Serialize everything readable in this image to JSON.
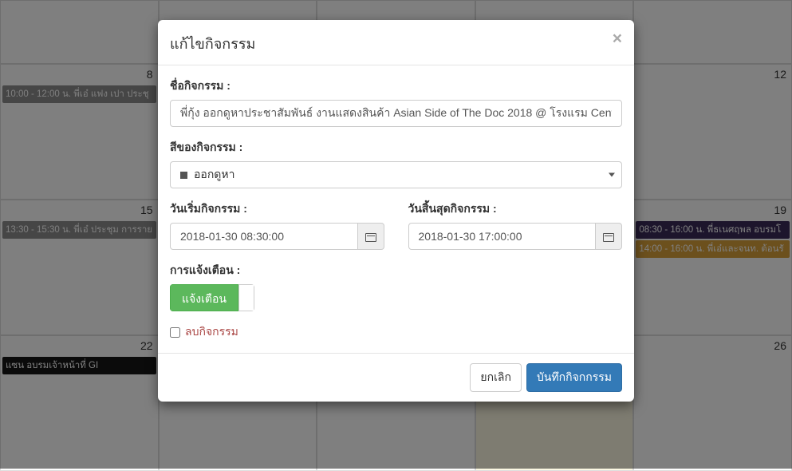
{
  "calendar": {
    "cells": [
      {
        "date": "",
        "events": []
      },
      {
        "date": "",
        "events": []
      },
      {
        "date": "",
        "events": []
      },
      {
        "date": "",
        "events": []
      },
      {
        "date": "",
        "events": []
      },
      {
        "date": "8",
        "events": [
          {
            "cls": "ev-grey",
            "text": "10:00 - 12:00 น. พี่เอ๋ แฟง เปา ประชุ"
          }
        ]
      },
      {
        "date": "",
        "events": []
      },
      {
        "date": "",
        "events": []
      },
      {
        "date": "",
        "events": []
      },
      {
        "date": "12",
        "events": []
      },
      {
        "date": "15",
        "events": [
          {
            "cls": "ev-grey",
            "text": "13:30 - 15:30 น. พี่เอ๋ ประชุม การราย"
          }
        ]
      },
      {
        "date": "",
        "events": []
      },
      {
        "date": "",
        "events": []
      },
      {
        "date": "",
        "events": []
      },
      {
        "date": "19",
        "events": [
          {
            "cls": "ev-purple",
            "text": "08:30 - 16:00 น. พี่ธเนศฤพล อบรมโ"
          },
          {
            "cls": "ev-orange sib",
            "text": "14:00 - 16:00 น. พี่เอ๋และจนท. ต้อนรั"
          }
        ]
      },
      {
        "date": "22",
        "events": [
          {
            "cls": "ev-black",
            "text": "แซน อบรมเจ้าหน้าที่ GI"
          }
        ]
      },
      {
        "date": "",
        "events": []
      },
      {
        "date": "",
        "events": []
      },
      {
        "date": "",
        "highlight": true,
        "events": []
      },
      {
        "date": "26",
        "events": []
      }
    ]
  },
  "modal": {
    "title": "แก้ไขกิจกรรม",
    "close_glyph": "×",
    "fields": {
      "name_label": "ชื่อกิจกรรม :",
      "name_value": "พี่กุ้ง ออกดูหาประชาสัมพันธ์ งานแสดงสินค้า Asian Side of The Doc 2018 @ โรงแรม Centara",
      "color_label": "สีของกิจกรรม :",
      "color_value": "ออกดูหา",
      "start_label": "วันเริ่มกิจกรรม :",
      "start_value": "2018-01-30 08:30:00",
      "end_label": "วันสิ้นสุดกิจกรรม :",
      "end_value": "2018-01-30 17:00:00",
      "notify_label": "การแจ้งเตือน :",
      "notify_on_text": "แจ้งเตือน",
      "delete_label": "ลบกิจกรรม"
    },
    "footer": {
      "cancel": "ยกเลิก",
      "save": "บันทึกกิจกกรรม"
    }
  }
}
